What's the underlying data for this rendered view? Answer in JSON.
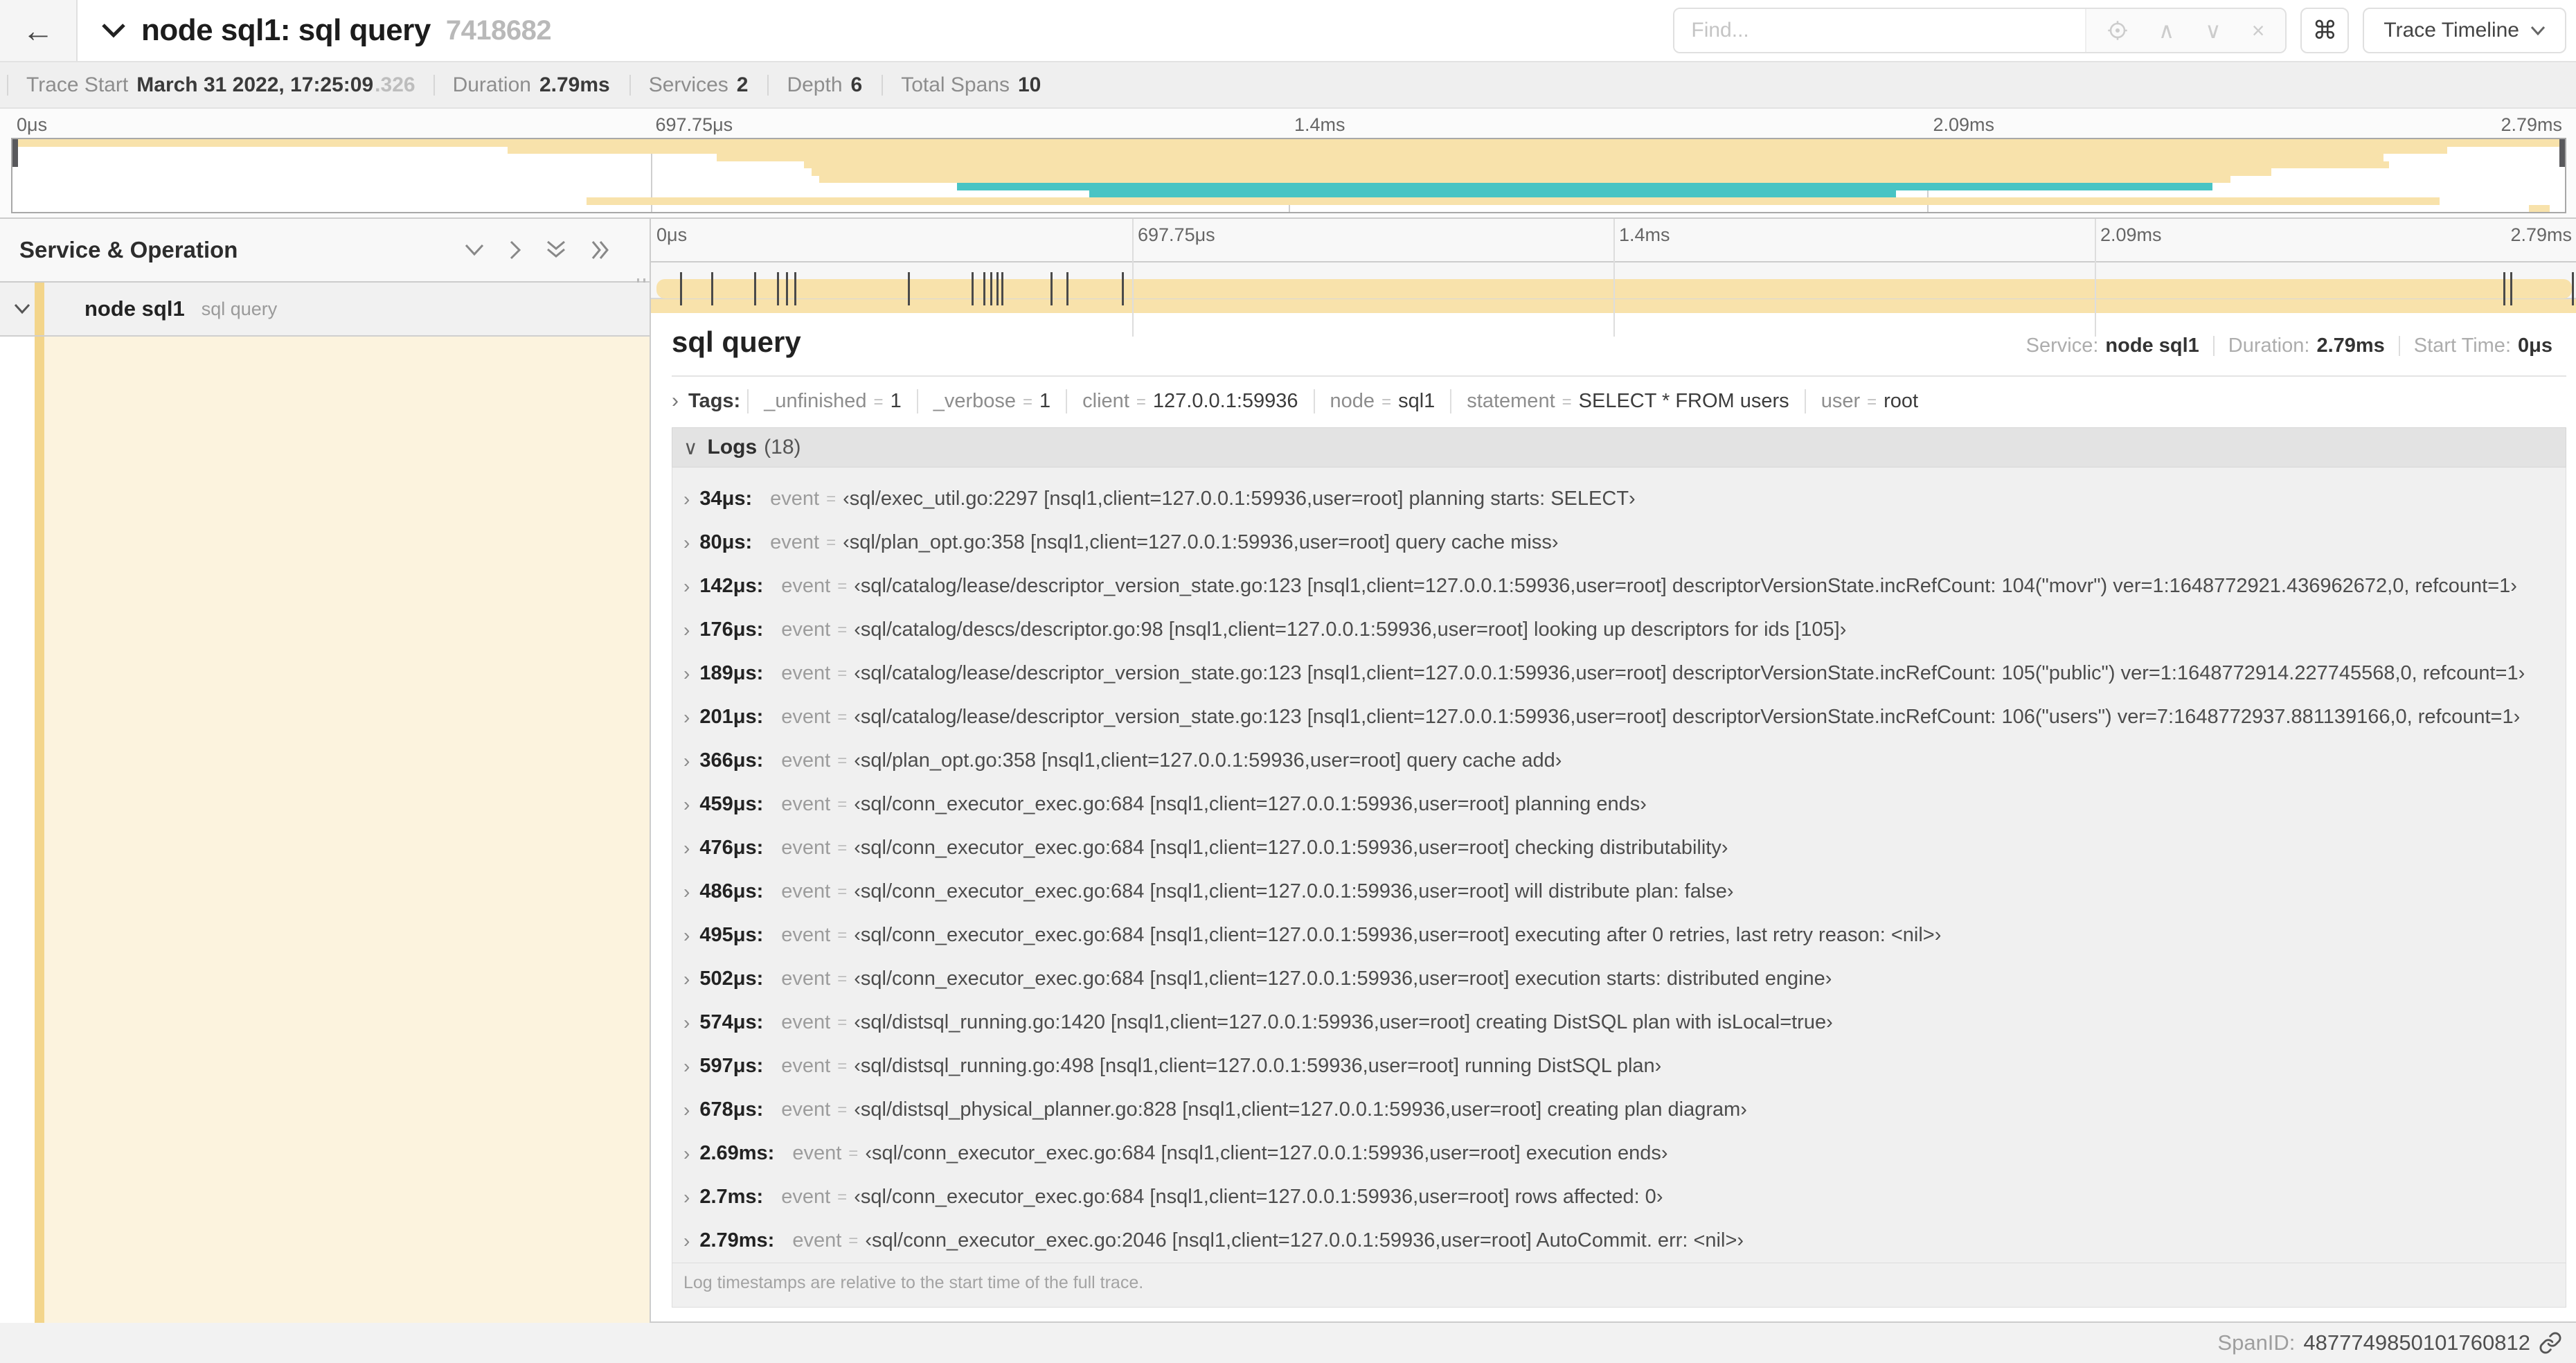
{
  "header": {
    "back_icon": "←",
    "title": "node sql1: sql query",
    "trace_id": "7418682",
    "find_placeholder": "Find...",
    "prev_icon": "∧",
    "next_icon": "∨",
    "clear_icon": "×",
    "shortcut_icon": "⌘",
    "view_label": "Trace Timeline"
  },
  "trace_summary": [
    {
      "label": "Trace Start",
      "value": "March 31 2022, 17:25:09",
      "suffix": ".326"
    },
    {
      "label": "Duration",
      "value": "2.79ms",
      "suffix": ""
    },
    {
      "label": "Services",
      "value": "2",
      "suffix": ""
    },
    {
      "label": "Depth",
      "value": "6",
      "suffix": ""
    },
    {
      "label": "Total Spans",
      "value": "10",
      "suffix": ""
    }
  ],
  "timeline": {
    "duration_us": 2790,
    "ruler_ticks": [
      {
        "label": "0μs",
        "pct": 0
      },
      {
        "label": "697.75μs",
        "pct": 25
      },
      {
        "label": "1.4ms",
        "pct": 50
      },
      {
        "label": "2.09ms",
        "pct": 75
      },
      {
        "label": "2.79ms",
        "pct": 100
      }
    ],
    "grid_pcts": [
      25,
      50,
      75
    ]
  },
  "colors": {
    "service_tan": "#f8e2ab",
    "service_tan_strip": "#f3d58b",
    "service_tan_fill": "#fcf3de",
    "service_teal": "#49c4c4"
  },
  "minimap": {
    "spans": [
      {
        "row": 0,
        "start": 0,
        "end": 100,
        "color": "service_tan"
      },
      {
        "row": 1,
        "start": 19.4,
        "end": 95.4,
        "color": "service_tan"
      },
      {
        "row": 2,
        "start": 27.6,
        "end": 92.9,
        "color": "service_tan"
      },
      {
        "row": 3,
        "start": 31.0,
        "end": 93.1,
        "color": "service_tan"
      },
      {
        "row": 4,
        "start": 31.3,
        "end": 88.5,
        "color": "service_tan"
      },
      {
        "row": 5,
        "start": 31.6,
        "end": 86.9,
        "color": "service_tan"
      },
      {
        "row": 6,
        "start": 37.0,
        "end": 86.2,
        "color": "service_teal"
      },
      {
        "row": 7,
        "start": 42.2,
        "end": 73.8,
        "color": "service_teal"
      },
      {
        "row": 8,
        "start": 22.5,
        "end": 95.1,
        "color": "service_tan"
      },
      {
        "row": 9,
        "start": 98.6,
        "end": 99.4,
        "color": "service_tan"
      }
    ]
  },
  "span_list": {
    "header": "Service & Operation",
    "rows": [
      {
        "service": "node sql1",
        "operation": "sql query"
      }
    ]
  },
  "detail": {
    "title": "sql query",
    "meta": [
      {
        "label": "Service:",
        "value": "node sql1"
      },
      {
        "label": "Duration:",
        "value": "2.79ms"
      },
      {
        "label": "Start Time:",
        "value": "0μs"
      }
    ],
    "tags_chevron": "›",
    "tags_label": "Tags:",
    "tags": [
      {
        "key": "_unfinished",
        "eq": "=",
        "value": "1"
      },
      {
        "key": "_verbose",
        "eq": "=",
        "value": "1"
      },
      {
        "key": "client",
        "eq": "=",
        "value": "127.0.0.1:59936"
      },
      {
        "key": "node",
        "eq": "=",
        "value": "sql1"
      },
      {
        "key": "statement",
        "eq": "=",
        "value": "SELECT * FROM users"
      },
      {
        "key": "user",
        "eq": "=",
        "value": "root"
      }
    ],
    "logs_chevron": "∨",
    "logs_label": "Logs",
    "logs_count": "(18)",
    "logs": [
      {
        "t": "34μs:",
        "us": 34,
        "k": "event",
        "eq": "=",
        "v": "‹sql/exec_util.go:2297 [nsql1,client=127.0.0.1:59936,user=root] planning starts: SELECT›"
      },
      {
        "t": "80μs:",
        "us": 80,
        "k": "event",
        "eq": "=",
        "v": "‹sql/plan_opt.go:358 [nsql1,client=127.0.0.1:59936,user=root] query cache miss›"
      },
      {
        "t": "142μs:",
        "us": 142,
        "k": "event",
        "eq": "=",
        "v": "‹sql/catalog/lease/descriptor_version_state.go:123 [nsql1,client=127.0.0.1:59936,user=root] descriptorVersionState.incRefCount: 104(\"movr\") ver=1:1648772921.436962672,0, refcount=1›"
      },
      {
        "t": "176μs:",
        "us": 176,
        "k": "event",
        "eq": "=",
        "v": "‹sql/catalog/descs/descriptor.go:98 [nsql1,client=127.0.0.1:59936,user=root] looking up descriptors for ids [105]›"
      },
      {
        "t": "189μs:",
        "us": 189,
        "k": "event",
        "eq": "=",
        "v": "‹sql/catalog/lease/descriptor_version_state.go:123 [nsql1,client=127.0.0.1:59936,user=root] descriptorVersionState.incRefCount: 105(\"public\") ver=1:1648772914.227745568,0, refcount=1›"
      },
      {
        "t": "201μs:",
        "us": 201,
        "k": "event",
        "eq": "=",
        "v": "‹sql/catalog/lease/descriptor_version_state.go:123 [nsql1,client=127.0.0.1:59936,user=root] descriptorVersionState.incRefCount: 106(\"users\") ver=7:1648772937.881139166,0, refcount=1›"
      },
      {
        "t": "366μs:",
        "us": 366,
        "k": "event",
        "eq": "=",
        "v": "‹sql/plan_opt.go:358 [nsql1,client=127.0.0.1:59936,user=root] query cache add›"
      },
      {
        "t": "459μs:",
        "us": 459,
        "k": "event",
        "eq": "=",
        "v": "‹sql/conn_executor_exec.go:684 [nsql1,client=127.0.0.1:59936,user=root] planning ends›"
      },
      {
        "t": "476μs:",
        "us": 476,
        "k": "event",
        "eq": "=",
        "v": "‹sql/conn_executor_exec.go:684 [nsql1,client=127.0.0.1:59936,user=root] checking distributability›"
      },
      {
        "t": "486μs:",
        "us": 486,
        "k": "event",
        "eq": "=",
        "v": "‹sql/conn_executor_exec.go:684 [nsql1,client=127.0.0.1:59936,user=root] will distribute plan: false›"
      },
      {
        "t": "495μs:",
        "us": 495,
        "k": "event",
        "eq": "=",
        "v": "‹sql/conn_executor_exec.go:684 [nsql1,client=127.0.0.1:59936,user=root] executing after 0 retries, last retry reason: <nil>›"
      },
      {
        "t": "502μs:",
        "us": 502,
        "k": "event",
        "eq": "=",
        "v": "‹sql/conn_executor_exec.go:684 [nsql1,client=127.0.0.1:59936,user=root] execution starts: distributed engine›"
      },
      {
        "t": "574μs:",
        "us": 574,
        "k": "event",
        "eq": "=",
        "v": "‹sql/distsql_running.go:1420 [nsql1,client=127.0.0.1:59936,user=root] creating DistSQL plan with isLocal=true›"
      },
      {
        "t": "597μs:",
        "us": 597,
        "k": "event",
        "eq": "=",
        "v": "‹sql/distsql_running.go:498 [nsql1,client=127.0.0.1:59936,user=root] running DistSQL plan›"
      },
      {
        "t": "678μs:",
        "us": 678,
        "k": "event",
        "eq": "=",
        "v": "‹sql/distsql_physical_planner.go:828 [nsql1,client=127.0.0.1:59936,user=root] creating plan diagram›"
      },
      {
        "t": "2.69ms:",
        "us": 2690,
        "k": "event",
        "eq": "=",
        "v": "‹sql/conn_executor_exec.go:684 [nsql1,client=127.0.0.1:59936,user=root] execution ends›"
      },
      {
        "t": "2.7ms:",
        "us": 2700,
        "k": "event",
        "eq": "=",
        "v": "‹sql/conn_executor_exec.go:684 [nsql1,client=127.0.0.1:59936,user=root] rows affected: 0›"
      },
      {
        "t": "2.79ms:",
        "us": 2790,
        "k": "event",
        "eq": "=",
        "v": "‹sql/conn_executor_exec.go:2046 [nsql1,client=127.0.0.1:59936,user=root] AutoCommit. err: <nil>›"
      }
    ],
    "footer_note": "Log timestamps are relative to the start time of the full trace.",
    "span_id_label": "SpanID:",
    "span_id": "4877749850101760812"
  }
}
